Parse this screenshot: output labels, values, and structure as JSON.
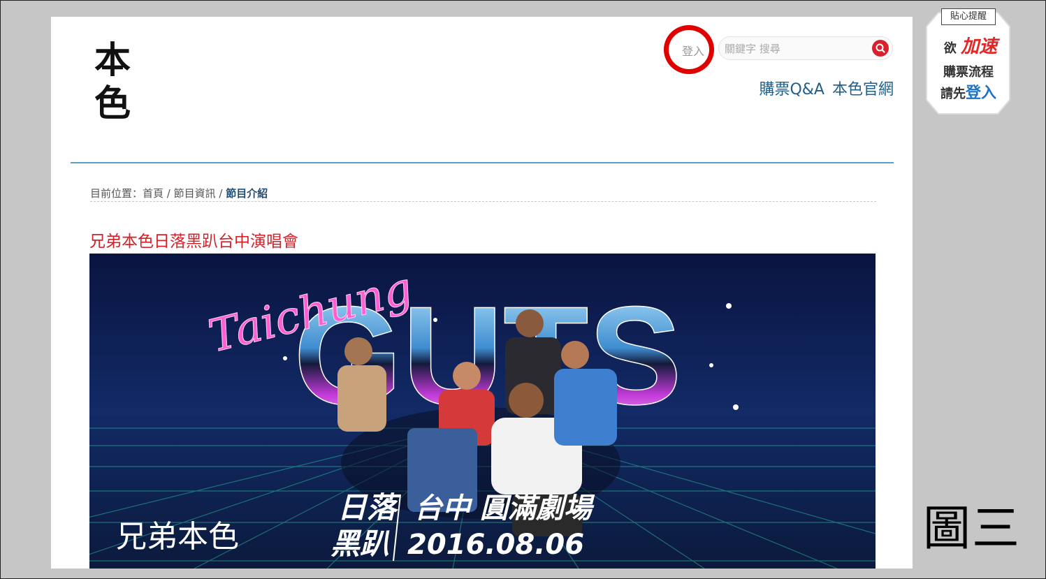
{
  "header": {
    "logo_text": "本色",
    "login_label": "登入",
    "search": {
      "placeholder": "關鍵字 搜尋",
      "value": ""
    },
    "links": [
      "購票Q&A",
      "本色官網"
    ]
  },
  "breadcrumb": {
    "prefix": "目前位置：",
    "items": [
      "首頁",
      "節目資訊",
      "節目介紹"
    ],
    "separator": " / "
  },
  "event": {
    "title": "兄弟本色日落黑趴台中演唱會"
  },
  "banner": {
    "script_text": "Taichung",
    "big_text": "GUTS",
    "logo_text": "兄弟本色",
    "line1_left": "日落",
    "line1_right": "台中 圓滿劇場",
    "line2_left": "黑趴",
    "line2_right": "2016.08.06"
  },
  "tip": {
    "title": "貼心提醒",
    "line1_prefix": "欲",
    "line1_accent": "加速",
    "line2": "購票流程",
    "line3_prefix": "請先",
    "line3_accent": "登入"
  },
  "figure_label": "圖三",
  "colors": {
    "accent_red": "#d2232a",
    "link_blue": "#1f5f8b",
    "annotation_circle": "#e10000"
  }
}
